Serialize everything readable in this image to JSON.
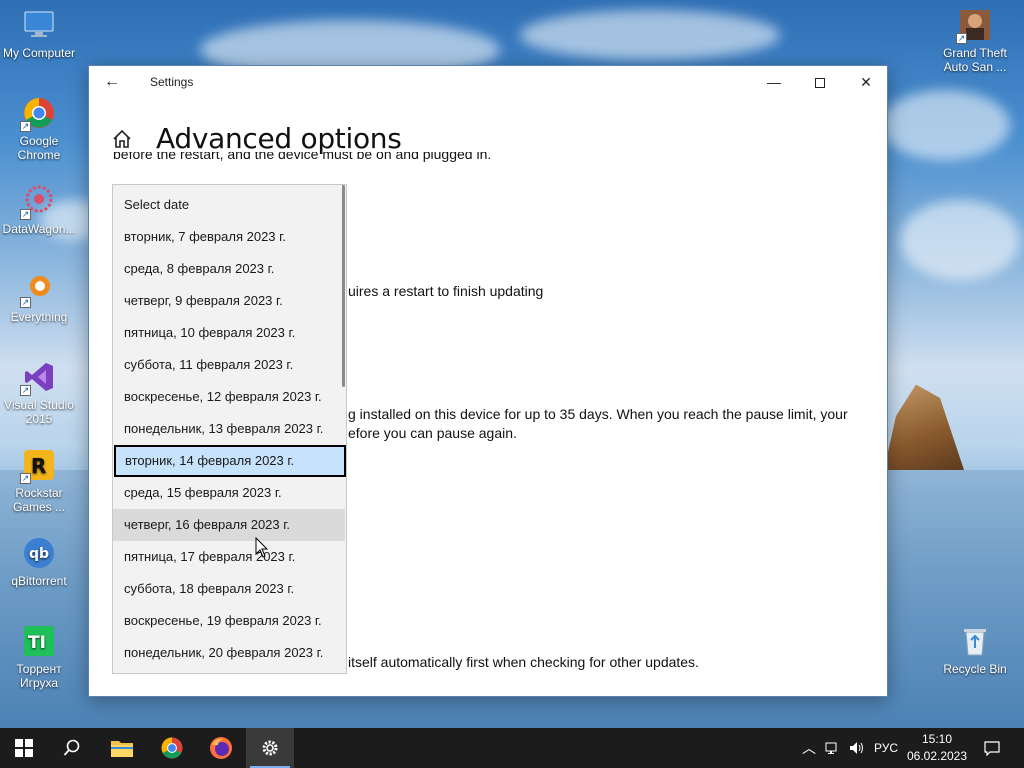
{
  "desktop": {
    "icons_left": [
      {
        "label": "My Computer"
      },
      {
        "label": "Google Chrome"
      },
      {
        "label": "DataWagon..."
      },
      {
        "label": "Everything"
      },
      {
        "label": "Visual Studio 2015"
      },
      {
        "label": "Rockstar Games ..."
      },
      {
        "label": "qBittorrent"
      },
      {
        "label": "Торрент Игруха"
      }
    ],
    "icons_right": [
      {
        "label": "Grand Theft Auto San ..."
      },
      {
        "label": "Recycle Bin"
      }
    ]
  },
  "window": {
    "title": "Settings",
    "page_title": "Advanced options",
    "text_cut_top": "before the restart, and the device must be on and plugged in.",
    "text_restart": "uires a restart to finish updating",
    "text_pause_1": "g installed on this device for up to 35 days. When you reach the pause limit, your",
    "text_pause_2": "efore you can pause again.",
    "text_bottom": "itself automatically first when checking for other updates."
  },
  "dropdown": {
    "items": [
      "Select date",
      "вторник, 7 февраля 2023 г.",
      "среда, 8 февраля 2023 г.",
      "четверг, 9 февраля 2023 г.",
      "пятница, 10 февраля 2023 г.",
      "суббота, 11 февраля 2023 г.",
      "воскресенье, 12 февраля 2023 г.",
      "понедельник, 13 февраля 2023 г.",
      "вторник, 14 февраля 2023 г.",
      "среда, 15 февраля 2023 г.",
      "четверг, 16 февраля 2023 г.",
      "пятница, 17 февраля 2023 г.",
      "суббота, 18 февраля 2023 г.",
      "воскресенье, 19 февраля 2023 г.",
      "понедельник, 20 февраля 2023 г."
    ],
    "selected": "вторник, 14 февраля 2023 г.",
    "hovered": "четверг, 16 февраля 2023 г."
  },
  "taskbar": {
    "language": "РУС",
    "time": "15:10",
    "date": "06.02.2023"
  },
  "colors": {
    "selection": "#c7e3fb",
    "hover": "#dadada",
    "taskbar": "#1c1c1c"
  }
}
